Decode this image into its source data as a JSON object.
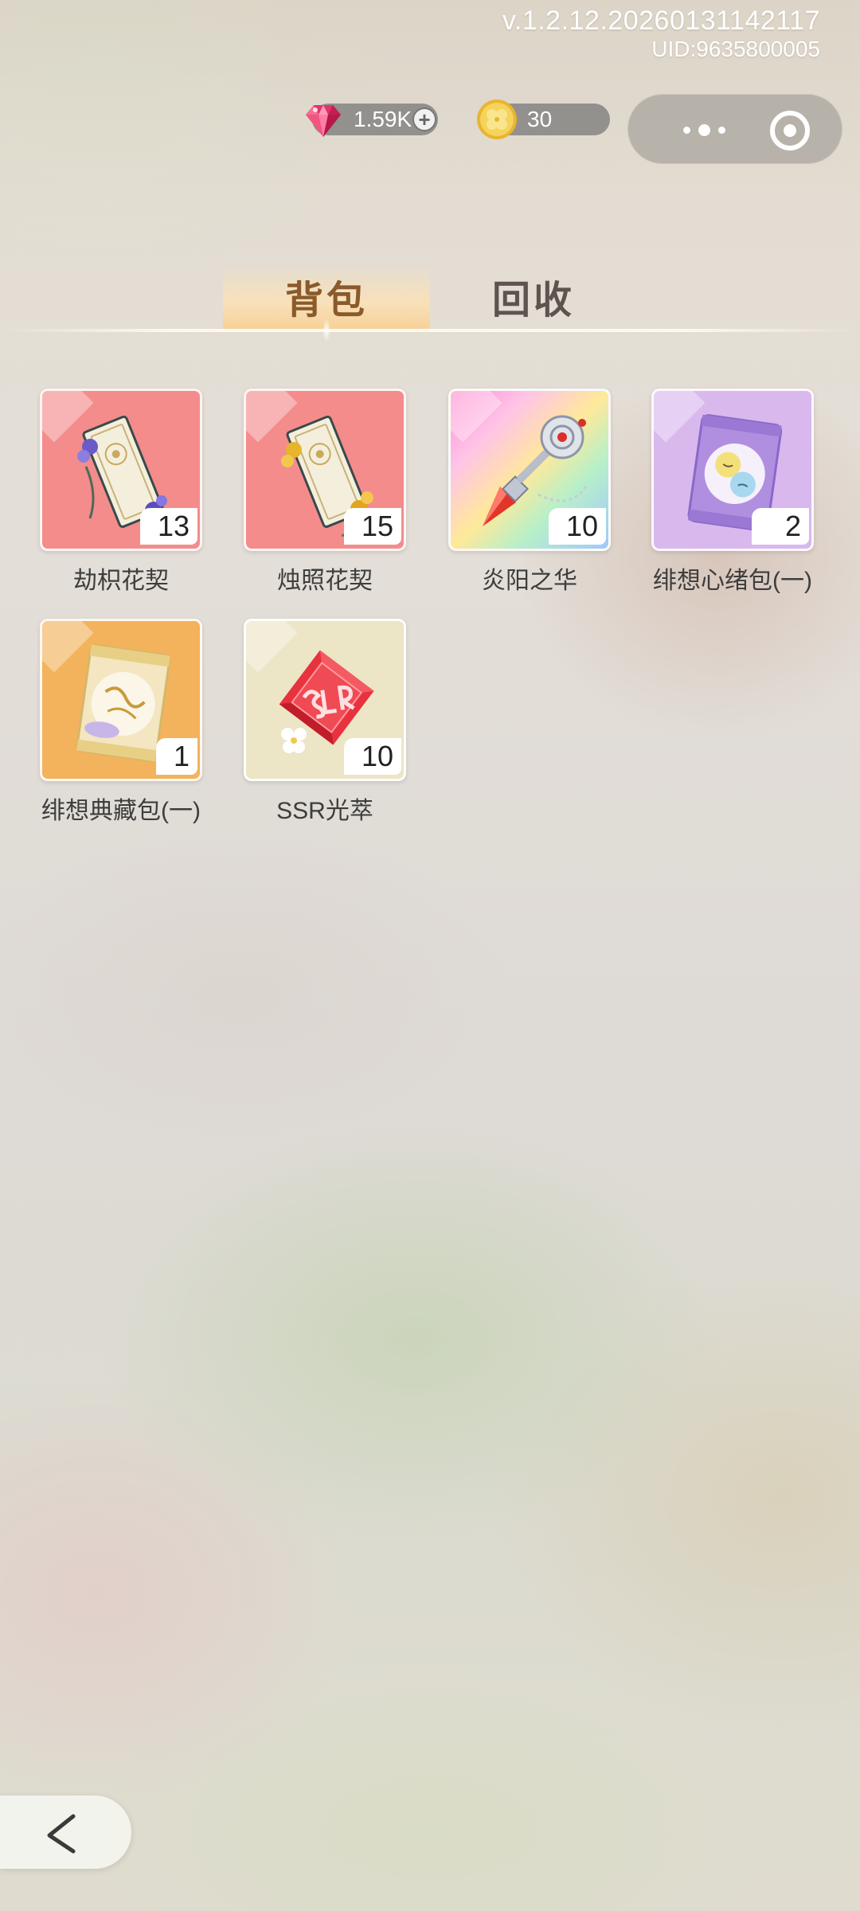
{
  "system": {
    "version": "v.1.2.12.20260131142117",
    "uid": "UID:9635800005"
  },
  "currencies": {
    "gems": {
      "value": "1.59K",
      "icon": "gem-icon",
      "add_label": "+"
    },
    "coins": {
      "value": "30",
      "icon": "clover-coin-icon"
    }
  },
  "capsule": {
    "more_icon": "more-dots-icon",
    "close_icon": "target-close-icon"
  },
  "tabs": [
    {
      "label": "背包",
      "active": true
    },
    {
      "label": "回收",
      "active": false
    }
  ],
  "items": [
    {
      "name": "劫枳花契",
      "count": "13",
      "icon": "purple-flower-contract-icon",
      "bg": "#f48c8c"
    },
    {
      "name": "烛照花契",
      "count": "15",
      "icon": "yellow-flower-contract-icon",
      "bg": "#f48c8c"
    },
    {
      "name": "炎阳之华",
      "count": "10",
      "icon": "crystal-scepter-icon",
      "bg": "rainbow"
    },
    {
      "name": "绯想心绪包(一)",
      "count": "2",
      "icon": "mood-pack-icon",
      "bg": "#d9b8ee"
    },
    {
      "name": "绯想典藏包(一)",
      "count": "1",
      "icon": "blooming-pack-icon",
      "bg": "#f2b35c"
    },
    {
      "name": "SSR光萃",
      "count": "10",
      "icon": "ssr-gem-icon",
      "bg": "#ece5c6"
    }
  ],
  "colors": {
    "active_tab_text": "#8a5a2a",
    "inactive_tab_text": "#5f5350",
    "red_card": "#f48c8c",
    "purple_card": "#d9b8ee",
    "orange_card": "#f2b35c",
    "cream_card": "#ece5c6"
  },
  "back_icon": "back-arrow-icon"
}
